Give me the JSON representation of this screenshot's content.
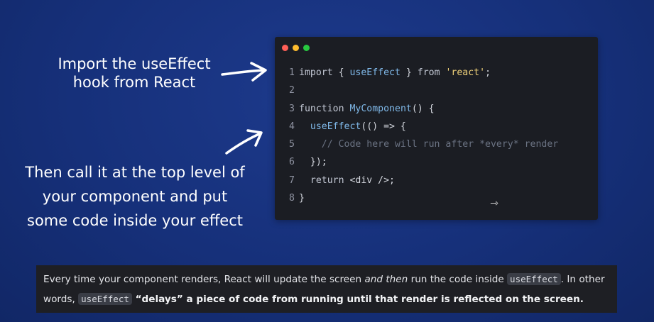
{
  "annotations": {
    "first_line1": "Import  the useEffect",
    "first_line2": "hook from React",
    "second_line1": "Then call it at the top level of",
    "second_line2": "your component and put",
    "second_line3": "some code inside your effect"
  },
  "window_dots": {
    "red": "#ff5f57",
    "yellow": "#febc2e",
    "green": "#28c840"
  },
  "code_lines": [
    {
      "num": "1",
      "kw": "import",
      "p1": " { ",
      "fn": "useEffect",
      "p2": " } ",
      "kw2": "from",
      "sp": " ",
      "str": "'react'",
      "end": ";"
    },
    {
      "num": "2"
    },
    {
      "num": "3",
      "kw": "function",
      "sp": " ",
      "fn": "MyComponent",
      "end": "() {"
    },
    {
      "num": "4",
      "indent": "  ",
      "fn": "useEffect",
      "end": "(() => {"
    },
    {
      "num": "5",
      "indent": "    ",
      "comment": "// Code here will run after *every* render"
    },
    {
      "num": "6",
      "indent": "  ",
      "end": "});"
    },
    {
      "num": "7",
      "indent": "  ",
      "kw": "return",
      "sp": " ",
      "end": "<div />;"
    },
    {
      "num": "8",
      "end": "}"
    }
  ],
  "caption": {
    "part1": "Every time your component renders, React will update the screen ",
    "em": "and then",
    "part2": " run the code inside ",
    "code1": "useEffect",
    "part3": ". In other words, ",
    "code2": "useEffect",
    "strong": " “delays” a piece of code from running until that render is reflected on the screen."
  },
  "icons": {
    "cursor": "mouse-pointer-icon",
    "arrows": "hand-drawn-arrow-icon"
  }
}
